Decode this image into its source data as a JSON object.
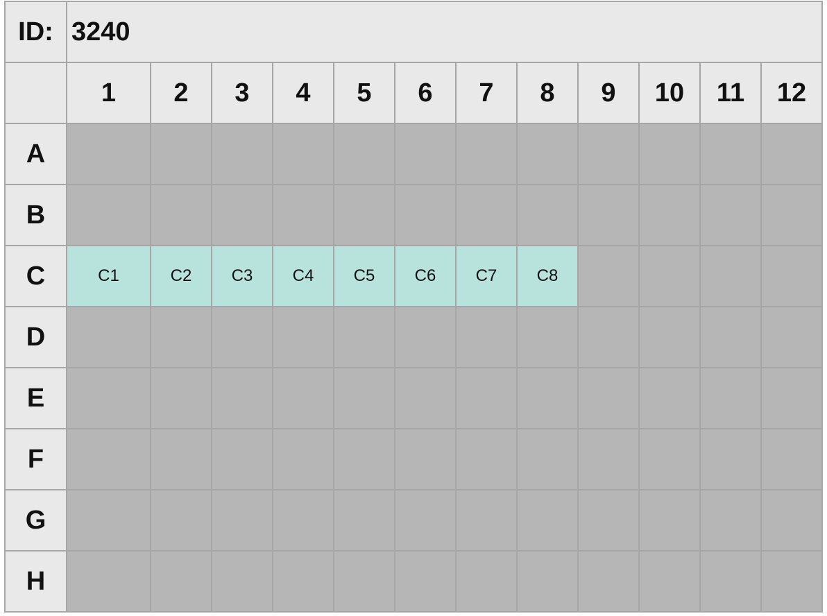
{
  "plate": {
    "id_label": "ID:",
    "id_value": "3240",
    "columns": [
      "1",
      "2",
      "3",
      "4",
      "5",
      "6",
      "7",
      "8",
      "9",
      "10",
      "11",
      "12"
    ],
    "rows": [
      "A",
      "B",
      "C",
      "D",
      "E",
      "F",
      "G",
      "H"
    ],
    "filled_wells": {
      "C1": "C1",
      "C2": "C2",
      "C3": "C3",
      "C4": "C4",
      "C5": "C5",
      "C6": "C6",
      "C7": "C7",
      "C8": "C8"
    },
    "colors": {
      "empty_well": "#b6b6b6",
      "filled_well": "#b8e3dd",
      "header": "#e9e9e9",
      "grid_line": "#a6a6a6"
    }
  }
}
